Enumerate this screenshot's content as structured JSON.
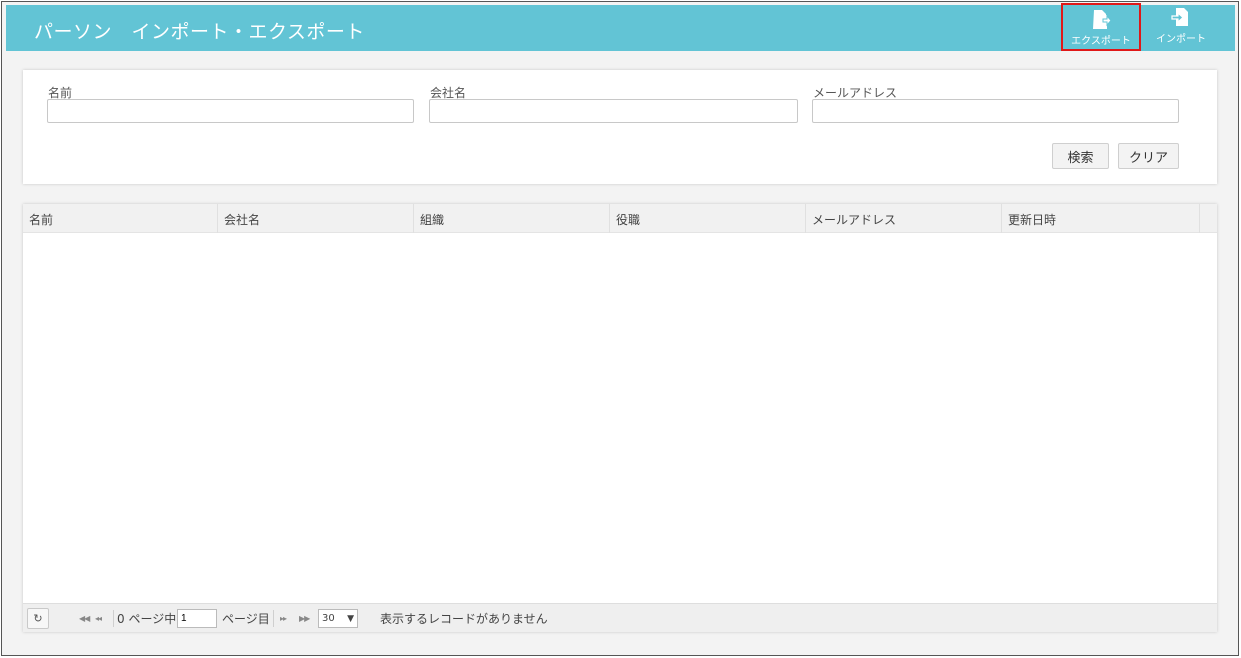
{
  "header": {
    "title": "パーソン　インポート・エクスポート",
    "export_label": "エクスポート",
    "import_label": "インポート"
  },
  "search": {
    "name_label": "名前",
    "company_label": "会社名",
    "email_label": "メールアドレス",
    "name_value": "",
    "company_value": "",
    "email_value": "",
    "search_button": "検索",
    "clear_button": "クリア"
  },
  "grid": {
    "columns": [
      "名前",
      "会社名",
      "組織",
      "役職",
      "メールアドレス",
      "更新日時"
    ],
    "rows": []
  },
  "pager": {
    "refresh_icon": "refresh-icon",
    "page_prefix": "0 ページ中",
    "page_value": "1",
    "page_suffix": "ページ目",
    "page_size": "30",
    "status": "表示するレコードがありません"
  }
}
